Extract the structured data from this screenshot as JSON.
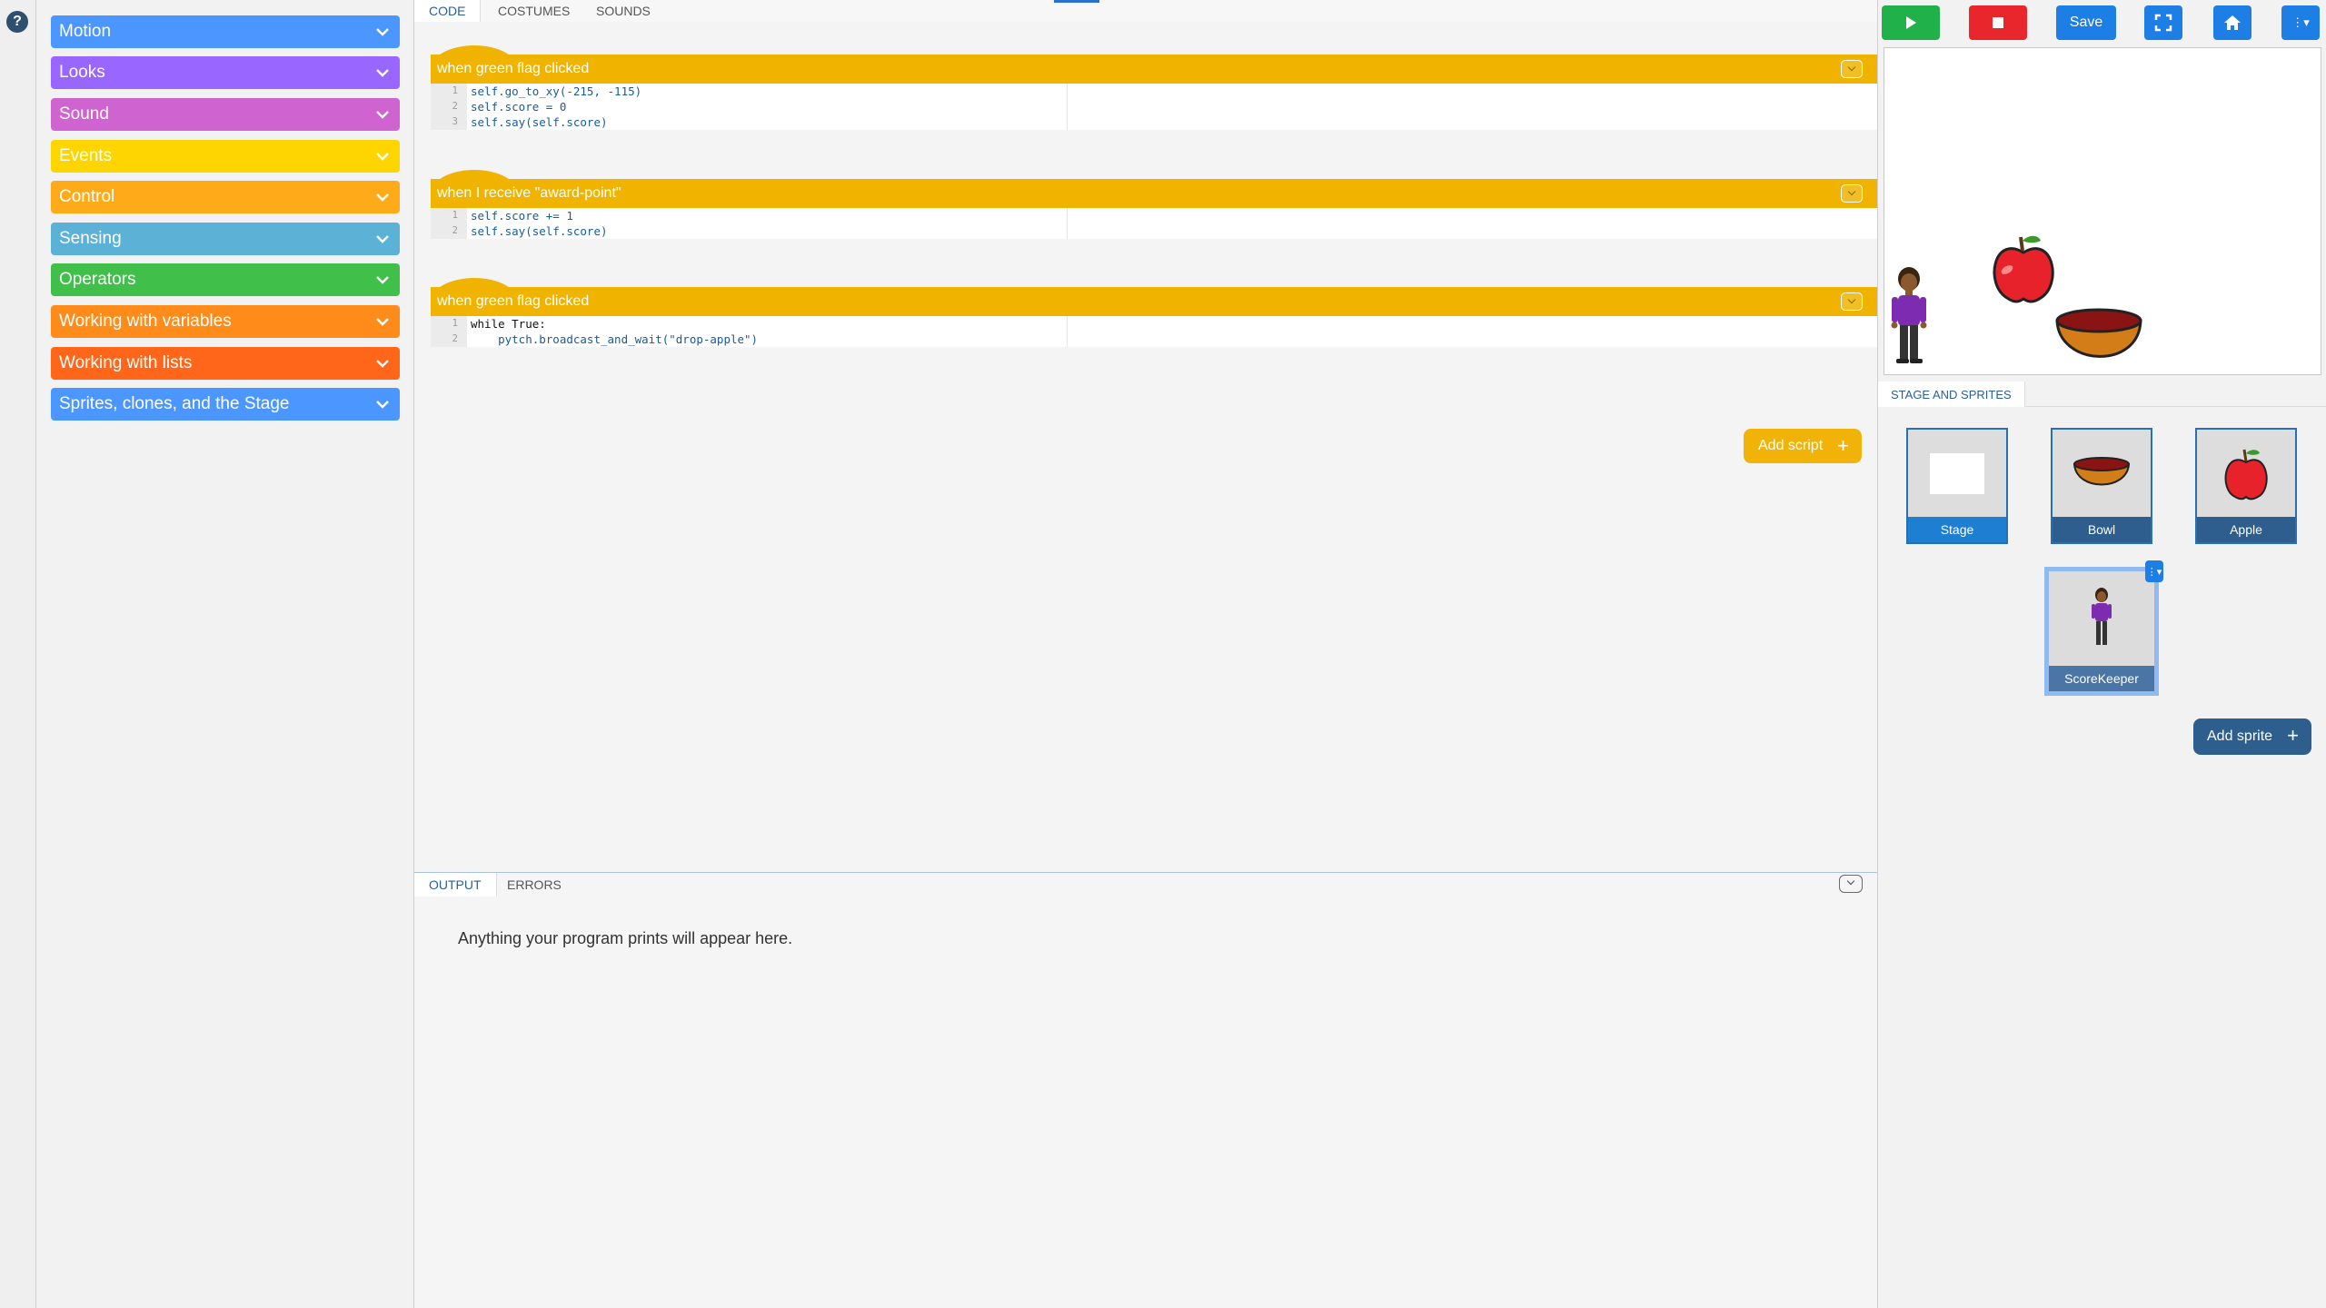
{
  "help": {
    "label": "?"
  },
  "palette": {
    "categories": [
      {
        "label": "Motion",
        "color": "#4c97ff"
      },
      {
        "label": "Looks",
        "color": "#9966ff"
      },
      {
        "label": "Sound",
        "color": "#cf63cf"
      },
      {
        "label": "Events",
        "color": "#ffd500"
      },
      {
        "label": "Control",
        "color": "#ffab19"
      },
      {
        "label": "Sensing",
        "color": "#5cb1d6"
      },
      {
        "label": "Operators",
        "color": "#40bf4a"
      },
      {
        "label": "Working with variables",
        "color": "#ff8c1a"
      },
      {
        "label": "Working with lists",
        "color": "#ff661a"
      },
      {
        "label": "Sprites, clones, and the Stage",
        "color": "#4c97ff"
      }
    ]
  },
  "code_tabs": {
    "code": "CODE",
    "costumes": "COSTUMES",
    "sounds": "SOUNDS"
  },
  "scripts": [
    {
      "hat": "when green flag clicked",
      "lines": [
        {
          "n": "1",
          "text": "self.go_to_xy(-215, -115)"
        },
        {
          "n": "2",
          "text": "self.score = 0"
        },
        {
          "n": "3",
          "text": "self.say(self.score)"
        }
      ]
    },
    {
      "hat": "when I receive \"award-point\"",
      "lines": [
        {
          "n": "1",
          "text": "self.score += 1"
        },
        {
          "n": "2",
          "text": "self.say(self.score)"
        }
      ]
    },
    {
      "hat": "when green flag clicked",
      "lines": [
        {
          "n": "1",
          "text": "while True:"
        },
        {
          "n": "2",
          "text": "    pytch.broadcast_and_wait(\"drop-apple\")"
        }
      ]
    }
  ],
  "add_script": {
    "label": "Add script",
    "plus": "+"
  },
  "output_panel": {
    "tab_output": "OUTPUT",
    "tab_errors": "ERRORS",
    "message": "Anything your program prints will appear here."
  },
  "toolbar": {
    "save": "Save",
    "menu": "⋮▾"
  },
  "sprites_panel": {
    "title": "STAGE AND SPRITES",
    "items": [
      {
        "name": "Stage",
        "selected": false
      },
      {
        "name": "Bowl",
        "selected": false
      },
      {
        "name": "Apple",
        "selected": false
      },
      {
        "name": "ScoreKeeper",
        "selected": true
      }
    ],
    "add_sprite": {
      "label": "Add sprite",
      "plus": "+"
    },
    "menu": "⋮▾"
  }
}
